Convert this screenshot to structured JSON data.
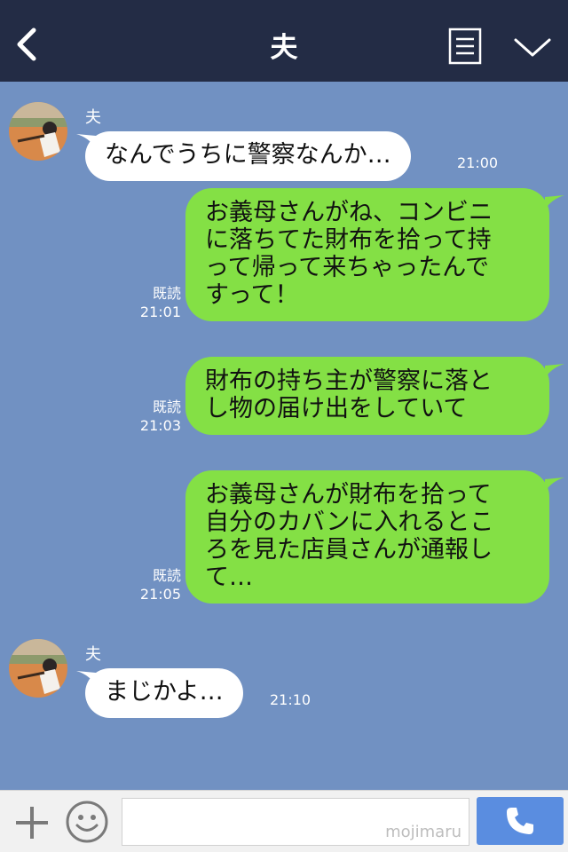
{
  "header": {
    "title": "夫",
    "back_icon": "chevron-left-icon",
    "menu_icon": "document-menu-icon",
    "dropdown_icon": "chevron-down-icon",
    "background": "#232c45"
  },
  "chat": {
    "background": "#7191c2",
    "incoming_bubble_color": "#ffffff",
    "outgoing_bubble_color": "#84e045",
    "messages": [
      {
        "direction": "in",
        "sender": "夫",
        "lines": [
          "なんでうちに警察なんか…"
        ],
        "time": "21:00"
      },
      {
        "direction": "out",
        "read": "既読",
        "lines": [
          "お義母さんがね、コンビニ",
          "に落ちてた財布を拾って持",
          "って帰って来ちゃったんで",
          "すって！"
        ],
        "time": "21:01"
      },
      {
        "direction": "out",
        "read": "既読",
        "lines": [
          "財布の持ち主が警察に落と",
          "し物の届け出をしていて"
        ],
        "time": "21:03"
      },
      {
        "direction": "out",
        "read": "既読",
        "lines": [
          "お義母さんが財布を拾って",
          "自分のカバンに入れるとこ",
          "ろを見た店員さんが通報し",
          "て…"
        ],
        "time": "21:05"
      },
      {
        "direction": "in",
        "sender": "夫",
        "lines": [
          "まじかよ…"
        ],
        "time": "21:10"
      }
    ]
  },
  "footer": {
    "add_icon": "plus-icon",
    "emoji_icon": "smiley-icon",
    "input_value": "",
    "watermark": "mojimaru",
    "call_icon": "phone-icon",
    "call_button_color": "#5a8de0"
  }
}
